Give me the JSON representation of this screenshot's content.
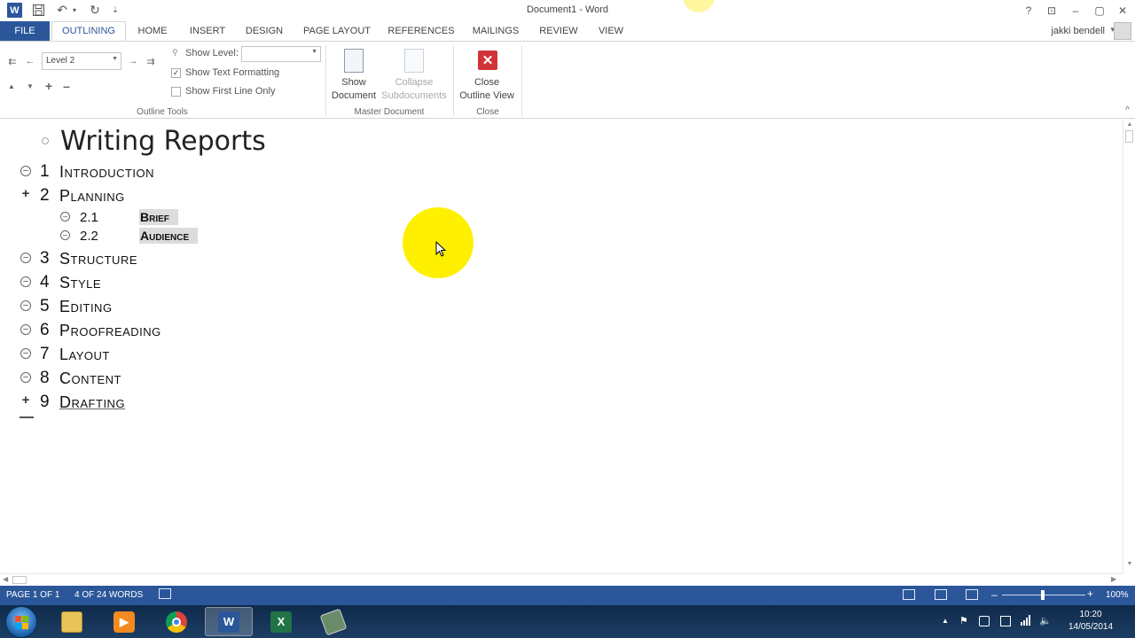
{
  "window": {
    "title": "Document1 - Word",
    "app_letter": "W",
    "help_icon": "?",
    "restore_ribbon_icon": "⊡",
    "minimize_icon": "–",
    "maximize_icon": "▢",
    "close_icon": "✕"
  },
  "qat": {
    "save_icon": "💾",
    "undo_icon": "↶",
    "undo_caret": "▾",
    "redo_icon": "↻",
    "customize_icon": "⇣"
  },
  "tabs": [
    {
      "label": "FILE"
    },
    {
      "label": "OUTLINING"
    },
    {
      "label": "HOME"
    },
    {
      "label": "INSERT"
    },
    {
      "label": "DESIGN"
    },
    {
      "label": "PAGE LAYOUT"
    },
    {
      "label": "REFERENCES"
    },
    {
      "label": "MAILINGS"
    },
    {
      "label": "REVIEW"
    },
    {
      "label": "VIEW"
    }
  ],
  "user": {
    "name": "jakki bendell",
    "caret": "▾"
  },
  "ribbon": {
    "outline_tools": {
      "promote_heading_icon": "⇇",
      "promote_icon": "←",
      "demote_icon": "→",
      "demote_body_icon": "⇉",
      "move_up_icon": "▲",
      "move_down_icon": "▼",
      "expand_icon": "+",
      "collapse_icon": "–",
      "level_value": "Level 2",
      "show_level_label": "Show Level:",
      "show_level_value": "",
      "show_text_formatting_label": "Show Text Formatting",
      "show_text_formatting_checked": true,
      "show_first_line_only_label": "Show First Line Only",
      "show_first_line_only_checked": false,
      "group_label": "Outline Tools"
    },
    "master_document": {
      "show_document_line1": "Show",
      "show_document_line2": "Document",
      "collapse_line1": "Collapse",
      "collapse_line2": "Subdocuments",
      "group_label": "Master Document"
    },
    "close": {
      "close_line1": "Close",
      "close_line2": "Outline View",
      "close_icon": "✕",
      "group_label": "Close"
    },
    "collapse_ribbon_icon": "^"
  },
  "document": {
    "title": "Writing Reports",
    "items": [
      {
        "num": "1",
        "text": "Introduction",
        "symbol": "minus"
      },
      {
        "num": "2",
        "text": "Planning",
        "symbol": "plus"
      },
      {
        "num": "3",
        "text": "Structure",
        "symbol": "minus"
      },
      {
        "num": "4",
        "text": "Style",
        "symbol": "minus"
      },
      {
        "num": "5",
        "text": "Editing",
        "symbol": "minus"
      },
      {
        "num": "6",
        "text": "Proofreading",
        "symbol": "minus"
      },
      {
        "num": "7",
        "text": "Layout",
        "symbol": "minus"
      },
      {
        "num": "8",
        "text": "Content",
        "symbol": "minus"
      },
      {
        "num": "9",
        "text": "Drafting",
        "symbol": "plus"
      }
    ],
    "subitems": [
      {
        "num": "2.1",
        "text": "Brief"
      },
      {
        "num": "2.2",
        "text": "Audience"
      }
    ]
  },
  "status": {
    "page": "PAGE 1 OF 1",
    "words": "4 OF 24 WORDS",
    "zoom": "100%",
    "zoom_minus": "–",
    "zoom_plus": "+"
  },
  "taskbar": {
    "word_letter": "W",
    "excel_letter": "X",
    "time": "10:20",
    "date": "14/05/2014",
    "tray_expand": "▲",
    "flag_icon": "⚑",
    "volume_icon": "🔈",
    "signal_icon": "▮"
  },
  "colors": {
    "accent": "#2b579a",
    "close_red": "#d13438",
    "highlight": "#fff000"
  }
}
